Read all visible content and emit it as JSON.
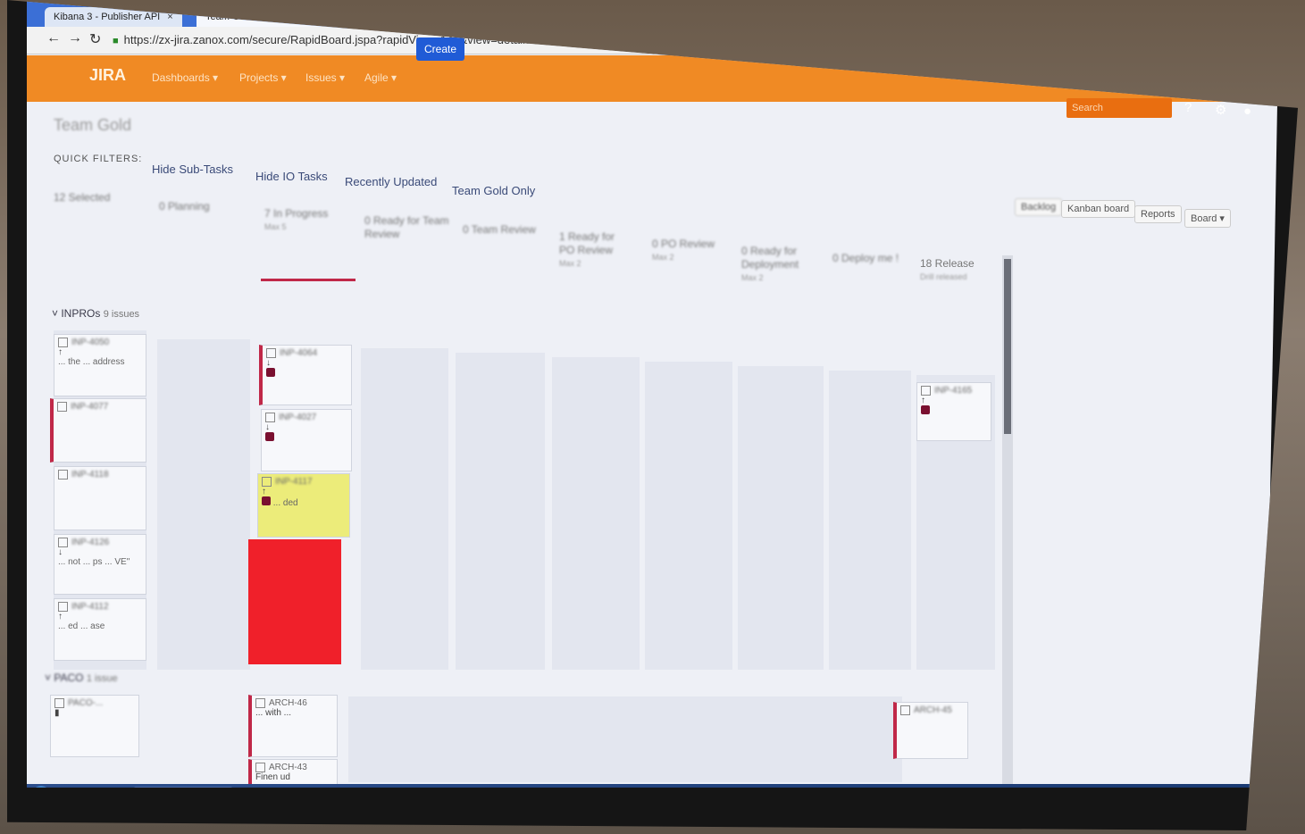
{
  "browser": {
    "tabs": [
      {
        "label": "Kibana 3 - Publisher API"
      },
      {
        "label": "Team Gold - Agile Board"
      }
    ],
    "url": "https://zx-jira.zanox.com/secure/RapidBoard.jspa?rapidView=141&view=detail&selectedIssue=ARCH-45"
  },
  "jira": {
    "logo": "JIRA",
    "menu": [
      "Dashboards ▾",
      "Projects ▾",
      "Issues ▾",
      "Agile ▾"
    ],
    "create_label": "Create",
    "search_placeholder": "Search"
  },
  "board": {
    "title": "Team Gold",
    "quick_filters_label": "QUICK FILTERS:",
    "quick_filters": [
      "Hide Sub-Tasks",
      "Hide IO Tasks",
      "Recently Updated",
      "Team Gold Only"
    ],
    "toolbar": [
      "Backlog",
      "Kanban board",
      "Reports",
      "Board ▾"
    ],
    "columns": [
      {
        "title": "12 Selected",
        "sub": ""
      },
      {
        "title": "0 Planning",
        "sub": ""
      },
      {
        "title": "7 In Progress",
        "sub": "Max 5"
      },
      {
        "title": "0 Ready for Team Review",
        "sub": ""
      },
      {
        "title": "0 Team Review",
        "sub": ""
      },
      {
        "title": "1 Ready for PO Review",
        "sub": "Max 2"
      },
      {
        "title": "0 PO Review",
        "sub": "Max 2"
      },
      {
        "title": "0 Ready for Deployment",
        "sub": "Max 2"
      },
      {
        "title": "0 Deploy me !",
        "sub": ""
      },
      {
        "title": "18 Release",
        "sub": "Drill released"
      }
    ],
    "swimlanes": [
      {
        "name": "INPROs",
        "count": "9 issues"
      },
      {
        "name": "PACO",
        "count": "1 issue"
      }
    ],
    "cards": {
      "selected": [
        {
          "key": "INP-4050",
          "summary": "... the ... address"
        },
        {
          "key": "INP-4077",
          "summary": ""
        },
        {
          "key": "INP-4118",
          "summary": ""
        },
        {
          "key": "INP-4126",
          "summary": "... not ... ps ... VE\""
        },
        {
          "key": "INP-4112",
          "summary": "... ed ... ase"
        },
        {
          "key": "PACO-...",
          "summary": ""
        }
      ],
      "in_progress": [
        {
          "key": "INP-4064",
          "summary": ""
        },
        {
          "key": "INP-4027",
          "summary": ""
        },
        {
          "key": "INP-4117",
          "summary": "... ded"
        },
        {
          "key": "ARCH-46",
          "summary": "... with ..."
        },
        {
          "key": "ARCH-43",
          "summary": "Finen ud"
        }
      ],
      "release": [
        {
          "key": "INP-4165",
          "summary": ""
        },
        {
          "key": "ARCH-45",
          "summary": ""
        }
      ]
    }
  }
}
